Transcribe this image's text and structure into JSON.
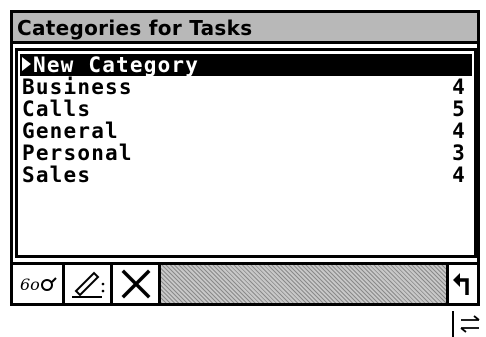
{
  "window": {
    "title": "Categories for Tasks"
  },
  "list": {
    "new_item": "New Category",
    "rows": [
      {
        "name": "Business",
        "count": "4"
      },
      {
        "name": "Calls",
        "count": "5"
      },
      {
        "name": "General",
        "count": "4"
      },
      {
        "name": "Personal",
        "count": "3"
      },
      {
        "name": "Sales",
        "count": "4"
      }
    ]
  },
  "toolbar": {
    "view_icon": "glasses-icon",
    "edit_icon": "pencil-icon",
    "delete_icon": "x-icon",
    "back_icon": "return-arrow-icon"
  },
  "status": {
    "scroll_icon": "scroll-arrows-icon"
  }
}
